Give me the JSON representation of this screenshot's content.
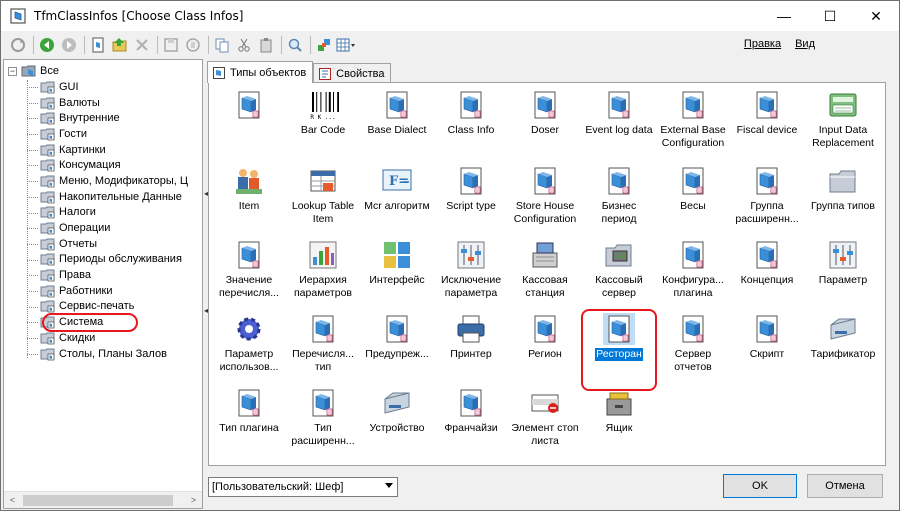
{
  "window": {
    "title": "TfmClassInfos [Choose Class Infos]"
  },
  "title_controls": {
    "minimize": "—",
    "maximize": "☐",
    "close": "✕"
  },
  "toolbar": {
    "icons": [
      "refresh-icon",
      "back-icon",
      "forward-icon",
      "new-icon",
      "open-icon",
      "delete-icon",
      "save-icon",
      "save-all-icon",
      "copy-icon",
      "cut-icon",
      "paste-icon",
      "find-icon",
      "tools-icon",
      "view-grid-icon"
    ]
  },
  "menu": {
    "edit": "Правка",
    "view": "Вид"
  },
  "tree": {
    "root": "Все",
    "items": [
      "GUI",
      "Валюты",
      "Внутренние",
      "Гости",
      "Картинки",
      "Консумация",
      "Меню, Модификаторы, Ц",
      "Накопительные Данные",
      "Налоги",
      "Операции",
      "Отчеты",
      "Периоды обслуживания",
      "Права",
      "Работники",
      "Сервис-печать",
      "Система",
      "Скидки",
      "Столы, Планы Залов"
    ]
  },
  "tabs": {
    "types": "Типы объектов",
    "properties": "Свойства"
  },
  "grid": {
    "items": [
      {
        "label": "",
        "icon": "cube"
      },
      {
        "label": "Bar Code",
        "icon": "barcode"
      },
      {
        "label": "Base Dialect",
        "icon": "cube"
      },
      {
        "label": "Class Info",
        "icon": "cube"
      },
      {
        "label": "Doser",
        "icon": "cube"
      },
      {
        "label": "Event log data",
        "icon": "cube"
      },
      {
        "label": "External Base Configuration",
        "icon": "cube"
      },
      {
        "label": "Fiscal device",
        "icon": "cube"
      },
      {
        "label": "Input Data Replacement",
        "icon": "calculator"
      },
      {
        "label": "Item",
        "icon": "people"
      },
      {
        "label": "Lookup Table Item",
        "icon": "lookup"
      },
      {
        "label": "Mcr алгоритм",
        "icon": "function"
      },
      {
        "label": "Script type",
        "icon": "cube"
      },
      {
        "label": "Store House Configuration",
        "icon": "cube"
      },
      {
        "label": "Бизнес период",
        "icon": "cube"
      },
      {
        "label": "Весы",
        "icon": "cube"
      },
      {
        "label": "Группа расширенн...",
        "icon": "cube"
      },
      {
        "label": "Группа типов",
        "icon": "folder"
      },
      {
        "label": "Значение перечисля...",
        "icon": "cube"
      },
      {
        "label": "Иерархия параметров",
        "icon": "chart"
      },
      {
        "label": "Интерфейс",
        "icon": "interface"
      },
      {
        "label": "Исключение параметра",
        "icon": "sliders"
      },
      {
        "label": "Кассовая станция",
        "icon": "register"
      },
      {
        "label": "Кассовый сервер",
        "icon": "server-folder"
      },
      {
        "label": "Конфигура... плагина",
        "icon": "cube"
      },
      {
        "label": "Концепция",
        "icon": "cube"
      },
      {
        "label": "Параметр",
        "icon": "sliders"
      },
      {
        "label": "Параметр использов...",
        "icon": "gear"
      },
      {
        "label": "Перечисля... тип",
        "icon": "cube"
      },
      {
        "label": "Предупреж...",
        "icon": "cube"
      },
      {
        "label": "Принтер",
        "icon": "printer"
      },
      {
        "label": "Регион",
        "icon": "cube"
      },
      {
        "label": "Ресторан",
        "icon": "cube"
      },
      {
        "label": "Сервер отчетов",
        "icon": "cube"
      },
      {
        "label": "Скрипт",
        "icon": "cube"
      },
      {
        "label": "Тарификатор",
        "icon": "drive"
      },
      {
        "label": "Тип плагина",
        "icon": "cube"
      },
      {
        "label": "Тип расширенн...",
        "icon": "cube"
      },
      {
        "label": "Устройство",
        "icon": "drive"
      },
      {
        "label": "Франчайзи",
        "icon": "cube"
      },
      {
        "label": "Элемент стоп листа",
        "icon": "stop"
      },
      {
        "label": "Ящик",
        "icon": "drawer"
      }
    ],
    "selected": "Ресторан"
  },
  "bottom": {
    "user_combo": "[Пользовательский: Шеф]",
    "ok": "OK",
    "cancel": "Отмена"
  },
  "colors": {
    "selection": "#0078d7",
    "highlight": "#e8171f"
  }
}
